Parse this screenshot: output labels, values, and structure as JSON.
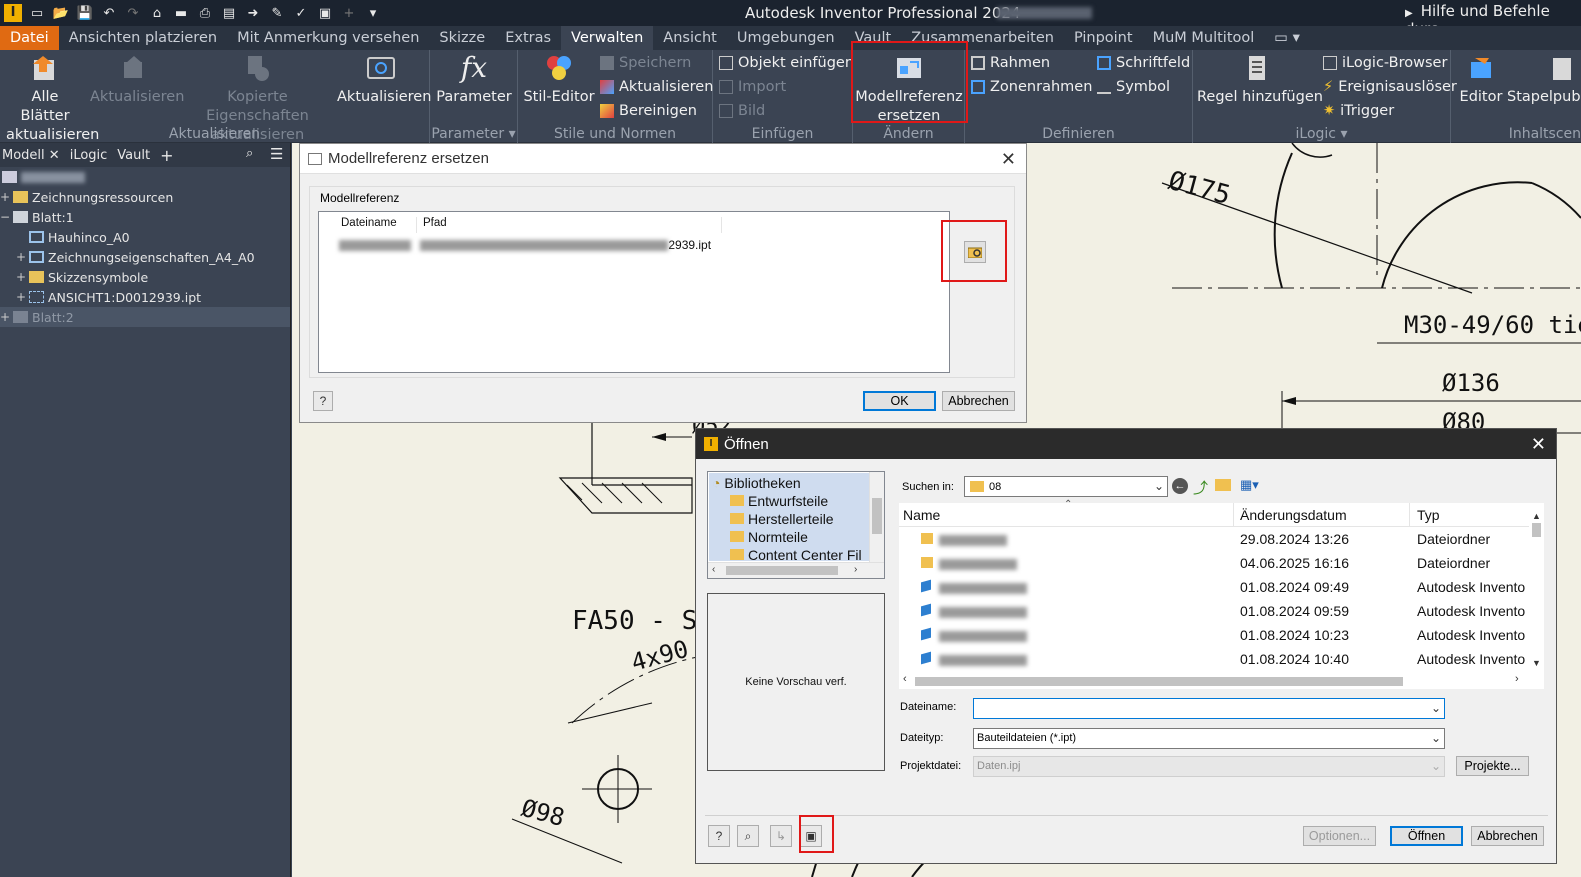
{
  "app": {
    "title": "Autodesk Inventor Professional 2024",
    "help_search": "Hilfe und Befehle durc"
  },
  "menu": [
    "Datei",
    "Ansichten platzieren",
    "Mit Anmerkung versehen",
    "Skizze",
    "Extras",
    "Verwalten",
    "Ansicht",
    "Umgebungen",
    "Vault",
    "Zusammenarbeiten",
    "Pinpoint",
    "MuM Multitool"
  ],
  "ribbon": {
    "aktualisieren": {
      "label": "Aktualisieren",
      "alle_blaetter": "Alle Blätter aktualisieren",
      "aktualisieren_dis": "Aktualisieren",
      "kopierte": "Kopierte Eigenschaften aktualisieren",
      "aktualisieren2": "Aktualisieren"
    },
    "parameter": {
      "label": "Parameter",
      "button": "Parameter"
    },
    "stile": {
      "label": "Stile und Normen",
      "stil_editor": "Stil-Editor",
      "speichern": "Speichern",
      "aktualisieren": "Aktualisieren",
      "bereinigen": "Bereinigen"
    },
    "einfuegen": {
      "label": "Einfügen",
      "objekt": "Objekt einfügen",
      "import": "Import",
      "bild": "Bild"
    },
    "aendern": {
      "label": "Ändern",
      "modellreferenz": "Modellreferenz ersetzen"
    },
    "definieren": {
      "label": "Definieren",
      "rahmen": "Rahmen",
      "zonenrahmen": "Zonenrahmen",
      "schriftfeld": "Schriftfeld",
      "symbol": "Symbol"
    },
    "ilogic": {
      "label": "iLogic",
      "regel": "Regel hinzufügen",
      "browser": "iLogic-Browser",
      "ereignis": "Ereignisauslöser",
      "itrigger": "iTrigger"
    },
    "inhalt": {
      "label": "Inhaltscen",
      "editor": "Editor",
      "stapel": "Stapelpub"
    }
  },
  "browser": {
    "tabs": [
      "Modell",
      "iLogic",
      "Vault"
    ],
    "tree": [
      {
        "label": "Zeichnungsressourcen",
        "indent": 0
      },
      {
        "label": "Blatt:1",
        "indent": 0
      },
      {
        "label": "Hauhinco_A0",
        "indent": 1
      },
      {
        "label": "Zeichnungseigenschaften_A4_A0",
        "indent": 1
      },
      {
        "label": "Skizzensymbole",
        "indent": 1
      },
      {
        "label": "ANSICHT1:D0012939.ipt",
        "indent": 1
      },
      {
        "label": "Blatt:2",
        "indent": 0
      }
    ]
  },
  "drawing": {
    "dim_175": "Ø175",
    "thread": "M30-49/60 tie",
    "dim_136": "Ø136",
    "dim_80": "Ø80",
    "dim_52": "Ø52",
    "fa": "FA50 - S0",
    "holes": "4x90",
    "dim_98": "Ø98"
  },
  "dlg_modellref": {
    "title": "Modellreferenz ersetzen",
    "group": "Modellreferenz",
    "col_dateiname": "Dateiname",
    "col_pfad": "Pfad",
    "path_suffix": "2939.ipt",
    "ok": "OK",
    "cancel": "Abbrechen"
  },
  "dlg_open": {
    "title": "Öffnen",
    "libraries": [
      "Bibliotheken",
      "Entwurfsteile",
      "Herstellerteile",
      "Normteile",
      "Content Center Fil"
    ],
    "preview": "Keine Vorschau verf.",
    "suchen_in_label": "Suchen in:",
    "suchen_in_value": "08",
    "columns": [
      "Name",
      "Änderungsdatum",
      "Typ"
    ],
    "files": [
      {
        "date": "29.08.2024 13:26",
        "type": "Dateiordner",
        "kind": "folder"
      },
      {
        "date": "04.06.2025 16:16",
        "type": "Dateiordner",
        "kind": "folder"
      },
      {
        "date": "01.08.2024 09:49",
        "type": "Autodesk Invento",
        "kind": "part"
      },
      {
        "date": "01.08.2024 09:59",
        "type": "Autodesk Invento",
        "kind": "part"
      },
      {
        "date": "01.08.2024 10:23",
        "type": "Autodesk Invento",
        "kind": "part"
      },
      {
        "date": "01.08.2024 10:40",
        "type": "Autodesk Invento",
        "kind": "part"
      }
    ],
    "dateiname_label": "Dateiname:",
    "dateiname_value": "",
    "dateityp_label": "Dateityp:",
    "dateityp_value": "Bauteildateien (*.ipt)",
    "projektdatei_label": "Projektdatei:",
    "projektdatei_value": "Daten.ipj",
    "projekte_btn": "Projekte...",
    "optionen_btn": "Optionen...",
    "oeffnen_btn": "Öffnen",
    "abbrechen_btn": "Abbrechen"
  },
  "colors": {
    "accent_file": "#e06a12",
    "highlight_red": "#e01818",
    "ribbon_bg": "#3b4453"
  }
}
